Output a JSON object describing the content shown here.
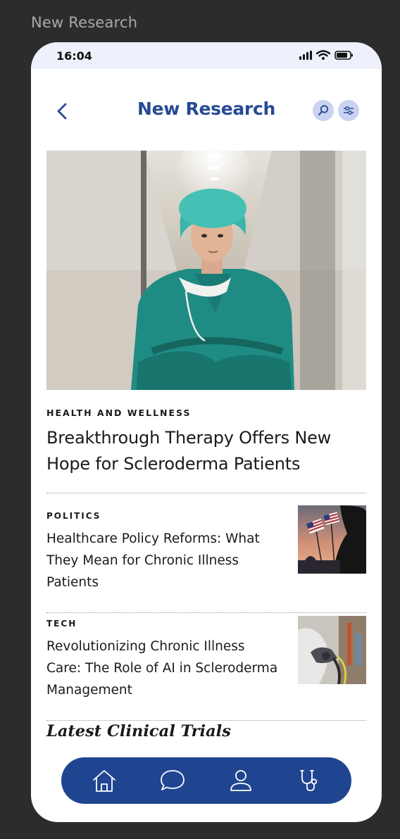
{
  "frame_label": "New Research",
  "status_bar": {
    "time": "16:04"
  },
  "header": {
    "title": "New Research"
  },
  "hero": {
    "category": "HEALTH AND WELLNESS",
    "title": "Breakthrough Therapy Offers New Hope for Scleroderma Patients"
  },
  "articles": [
    {
      "category": "POLITICS",
      "title": "Healthcare Policy Reforms: What They Mean for Chronic Illness Patients"
    },
    {
      "category": "TECH",
      "title": "Revolutionizing Chronic Illness Care: The Role of AI in Scleroderma Management"
    }
  ],
  "section": {
    "title": "Latest Clinical Trials"
  },
  "icons": {
    "back": "chevron-left-icon",
    "search": "search-icon",
    "filter": "sliders-icon",
    "nav": [
      "home-icon",
      "chat-icon",
      "user-icon",
      "stethoscope-icon"
    ]
  },
  "colors": {
    "accent": "#264a93",
    "nav_bg": "#1f4591",
    "icon_bubble": "#c9d3f1",
    "status_bg": "#eef1fb"
  }
}
